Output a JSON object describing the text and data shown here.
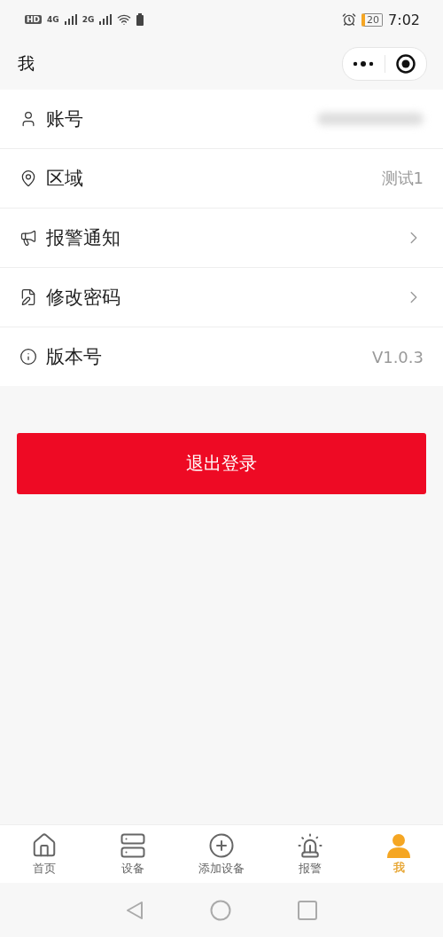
{
  "status_bar": {
    "hd": "HD",
    "net_1": "4G",
    "net_2": "2G",
    "battery": "20",
    "time": "7:02"
  },
  "header": {
    "title": "我"
  },
  "settings": [
    {
      "label": "账号",
      "kind": "blurred"
    },
    {
      "label": "区域",
      "kind": "value",
      "value": "测试1"
    },
    {
      "label": "报警通知",
      "kind": "link"
    },
    {
      "label": "修改密码",
      "kind": "link"
    },
    {
      "label": "版本号",
      "kind": "value",
      "value": "V1.0.3"
    }
  ],
  "logout_button": "退出登录",
  "tab_bar": [
    {
      "label": "首页",
      "selected": false
    },
    {
      "label": "设备",
      "selected": false
    },
    {
      "label": "添加设备",
      "selected": false
    },
    {
      "label": "报警",
      "selected": false
    },
    {
      "label": "我",
      "selected": true
    }
  ]
}
